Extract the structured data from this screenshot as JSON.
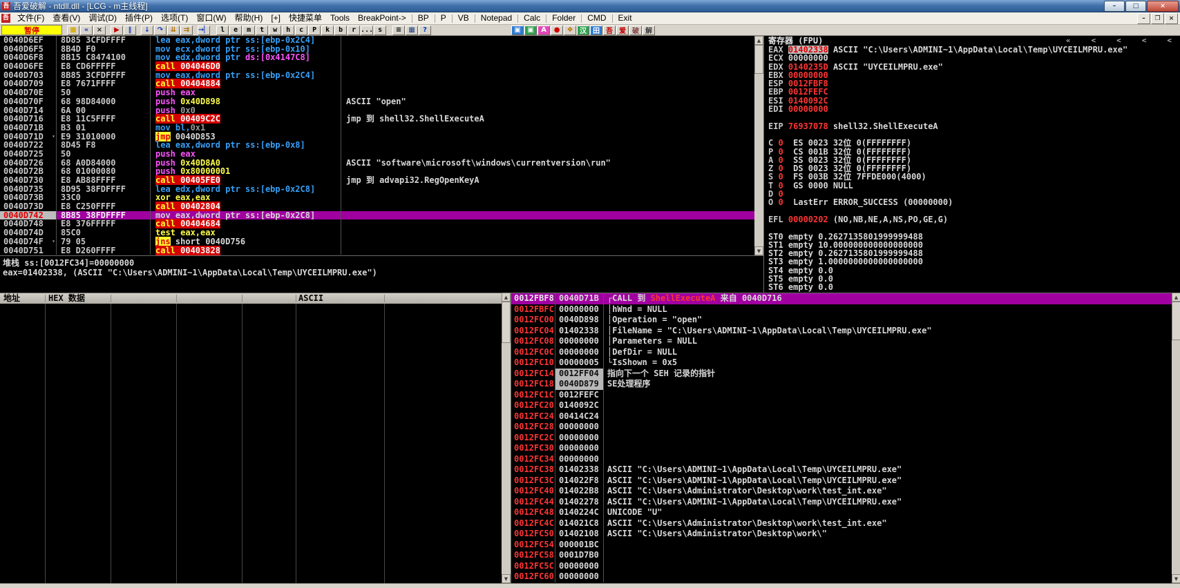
{
  "window": {
    "title": "吾爱破解 - ntdll.dll - [LCG - m主线程]",
    "icon_char": "吾",
    "controls": {
      "minimize": "–",
      "maximize": "□",
      "close": "×"
    },
    "mdi_controls": {
      "minimize": "–",
      "restore": "❐",
      "close": "×"
    }
  },
  "scrollbar": {
    "up": "▲",
    "down": "▼"
  },
  "menu": {
    "items": [
      {
        "label": "文件(F)"
      },
      {
        "label": "查看(V)"
      },
      {
        "label": "调试(D)"
      },
      {
        "label": "插件(P)"
      },
      {
        "label": "选项(T)"
      },
      {
        "label": "窗口(W)"
      },
      {
        "label": "帮助(H)"
      },
      {
        "label": "[+]"
      },
      {
        "label": "快捷菜单"
      },
      {
        "label": "Tools"
      },
      {
        "label": "BreakPoint->"
      },
      {
        "label": "BP",
        "sep_before": true
      },
      {
        "label": "P",
        "sep_before": true
      },
      {
        "label": "VB",
        "sep_before": true
      },
      {
        "label": "Notepad",
        "sep_before": true
      },
      {
        "label": "Calc",
        "sep_before": true
      },
      {
        "label": "Folder",
        "sep_before": true
      },
      {
        "label": "CMD",
        "sep_before": true
      },
      {
        "label": "Exit",
        "sep_before": true
      }
    ]
  },
  "toolbar": {
    "status_label": "暂停",
    "main_buttons": [
      {
        "name": "open-file-button",
        "glyph": "■",
        "fg": "#D8B020"
      },
      {
        "name": "restart-button",
        "glyph": "«",
        "fg": "#2040C0"
      },
      {
        "name": "close-program-button",
        "glyph": "×",
        "fg": "#202020"
      },
      {
        "name": "run-button",
        "glyph": "▶",
        "fg": "#C00000",
        "gap": true
      },
      {
        "name": "pause-button",
        "glyph": "‖",
        "fg": "#2040C0"
      },
      {
        "name": "step-into-button",
        "glyph": "↓",
        "fg": "#2040C0",
        "gap": true
      },
      {
        "name": "step-over-button",
        "glyph": "↷",
        "fg": "#2040C0"
      },
      {
        "name": "animate-into-button",
        "glyph": "⇊",
        "fg": "#B07000"
      },
      {
        "name": "animate-over-button",
        "glyph": "⇉",
        "fg": "#B07000"
      },
      {
        "name": "run-to-return-button",
        "glyph": "→▏",
        "fg": "#2040C0",
        "gap": true
      }
    ],
    "letter_buttons": [
      "l",
      "e",
      "m",
      "t",
      "w",
      "h",
      "c",
      "P",
      "k",
      "b",
      "r",
      "...",
      "s"
    ],
    "extra_buttons": [
      {
        "name": "breakpoint-list-button",
        "glyph": "≡",
        "fg": "#000000"
      },
      {
        "name": "patch-window-button",
        "glyph": "▦",
        "fg": "#204080"
      },
      {
        "name": "help-button",
        "glyph": "?",
        "fg": "#0040C0"
      }
    ],
    "plugin_buttons": [
      {
        "name": "terminal-plugin-icon",
        "glyph": "▣",
        "fg": "#FFFFFF",
        "bg": "#2F7BD0"
      },
      {
        "name": "green-tool-plugin-icon",
        "glyph": "▣",
        "fg": "#FFFFFF",
        "bg": "#2FA050"
      },
      {
        "name": "api-break-plugin-icon",
        "glyph": "A",
        "fg": "#FFFFFF",
        "bg": "#E048B8"
      },
      {
        "name": "record-plugin-icon",
        "glyph": "●",
        "fg": "#D00000",
        "bg": "#D8D4CB"
      },
      {
        "name": "spider-plugin-icon",
        "glyph": "❖",
        "fg": "#C07000",
        "bg": "#D8D4CB"
      },
      {
        "name": "chinese-tool-plugin-icon",
        "glyph": "汉",
        "fg": "#FFFFFF",
        "bg": "#2FA050"
      },
      {
        "name": "grid-plugin-icon",
        "glyph": "田",
        "fg": "#FFFFFF",
        "bg": "#2F7BD0"
      },
      {
        "name": "wu-plugin-icon",
        "glyph": "吾",
        "fg": "#C00000",
        "bg": "#D8D4CB"
      },
      {
        "name": "ai-plugin-icon",
        "glyph": "爱",
        "fg": "#C00000",
        "bg": "#D8D4CB"
      },
      {
        "name": "po-plugin-icon",
        "glyph": "破",
        "fg": "#804040",
        "bg": "#D8D4CB"
      },
      {
        "name": "jie-plugin-icon",
        "glyph": "解",
        "fg": "#404040",
        "bg": "#D8D4CB"
      }
    ]
  },
  "disasm": {
    "rows": [
      {
        "a": "0040D6EF",
        "b": "8D85 3CFDFFFF",
        "ins": [
          [
            "lea eax,dword ptr ss:[ebp-0x2C4]",
            "b"
          ]
        ],
        "cm": ""
      },
      {
        "a": "0040D6F5",
        "b": "8B4D F0",
        "ins": [
          [
            "mov ecx,dword ptr ss:[ebp-0x10]",
            "b"
          ]
        ],
        "cm": ""
      },
      {
        "a": "0040D6F8",
        "b": "8B15 C8474100",
        "ins": [
          [
            "mov edx,dword ptr ",
            "b"
          ],
          [
            "ds:[0x4147C8]",
            "m"
          ]
        ],
        "cm": ""
      },
      {
        "a": "0040D6FE",
        "b": "E8 CD6FFFFF",
        "ins": [
          [
            "call",
            "cr"
          ],
          [
            " 004046D0",
            "co"
          ]
        ],
        "cm": ""
      },
      {
        "a": "0040D703",
        "b": "8B85 3CFDFFFF",
        "ins": [
          [
            "mov eax,dword ptr ss:[ebp-0x2C4]",
            "b"
          ]
        ],
        "cm": ""
      },
      {
        "a": "0040D709",
        "b": "E8 7671FFFF",
        "ins": [
          [
            "call",
            "cr"
          ],
          [
            " 00404884",
            "co"
          ]
        ],
        "cm": ""
      },
      {
        "a": "0040D70E",
        "b": "50",
        "ins": [
          [
            "push eax",
            "m"
          ]
        ],
        "cm": ""
      },
      {
        "a": "0040D70F",
        "b": "68 98D84000",
        "ins": [
          [
            "push ",
            "m"
          ],
          [
            "0x40D898",
            "y"
          ]
        ],
        "cm": "ASCII \"open\""
      },
      {
        "a": "0040D714",
        "b": "6A 00",
        "ins": [
          [
            "push ",
            "m"
          ],
          [
            "0x0",
            "g"
          ]
        ],
        "cm": ""
      },
      {
        "a": "0040D716",
        "b": "E8 11C5FFFF",
        "ins": [
          [
            "call",
            "cr"
          ],
          [
            " 00409C2C",
            "co"
          ]
        ],
        "cm": "jmp 到 shell32.ShellExecuteA"
      },
      {
        "a": "0040D71B",
        "b": "B3 01",
        "ins": [
          [
            "mov bl,",
            "b"
          ],
          [
            "0x1",
            "g"
          ]
        ],
        "cm": ""
      },
      {
        "a": "0040D71D",
        "b": "E9 31010000",
        "ins": [
          [
            "jmp",
            "j"
          ],
          [
            " 0040D853",
            "w"
          ]
        ],
        "cm": "",
        "mk": "▾"
      },
      {
        "a": "0040D722",
        "b": "8D45 F8",
        "ins": [
          [
            "lea eax,dword ptr ss:[ebp-0x8]",
            "b"
          ]
        ],
        "cm": ""
      },
      {
        "a": "0040D725",
        "b": "50",
        "ins": [
          [
            "push eax",
            "m"
          ]
        ],
        "cm": ""
      },
      {
        "a": "0040D726",
        "b": "68 A0D84000",
        "ins": [
          [
            "push ",
            "m"
          ],
          [
            "0x40D8A0",
            "y"
          ]
        ],
        "cm": "ASCII \"software\\microsoft\\windows\\currentversion\\run\""
      },
      {
        "a": "0040D72B",
        "b": "68 01000080",
        "ins": [
          [
            "push ",
            "m"
          ],
          [
            "0x80000001",
            "y"
          ]
        ],
        "cm": ""
      },
      {
        "a": "0040D730",
        "b": "E8 AB88FFFF",
        "ins": [
          [
            "call",
            "cr"
          ],
          [
            " 00405FE0",
            "co"
          ]
        ],
        "cm": "jmp 到 advapi32.RegOpenKeyA"
      },
      {
        "a": "0040D735",
        "b": "8D95 38FDFFFF",
        "ins": [
          [
            "lea edx,dword ptr ss:[ebp-0x2C8]",
            "b"
          ]
        ],
        "cm": ""
      },
      {
        "a": "0040D73B",
        "b": "33C0",
        "ins": [
          [
            "xor eax,eax",
            "y"
          ]
        ],
        "cm": ""
      },
      {
        "a": "0040D73D",
        "b": "E8 C250FFFF",
        "ins": [
          [
            "call",
            "cr"
          ],
          [
            " 00402804",
            "co"
          ]
        ],
        "cm": ""
      },
      {
        "a": "0040D742",
        "b": "8B85 38FDFFFF",
        "ins": [
          [
            "mov eax,dword ptr ss:[ebp-0x2C8]",
            "w"
          ]
        ],
        "cm": "",
        "sel": true
      },
      {
        "a": "0040D748",
        "b": "E8 376FFFFF",
        "ins": [
          [
            "call",
            "cr"
          ],
          [
            " 00404684",
            "co"
          ]
        ],
        "cm": ""
      },
      {
        "a": "0040D74D",
        "b": "85C0",
        "ins": [
          [
            "test eax,eax",
            "y"
          ]
        ],
        "cm": ""
      },
      {
        "a": "0040D74F",
        "b": "79 05",
        "ins": [
          [
            "jns",
            "j"
          ],
          [
            " short 0040D756",
            "w"
          ]
        ],
        "cm": "",
        "mk": "▾"
      },
      {
        "a": "0040D751",
        "b": "E8 D260FFFF",
        "ins": [
          [
            "call",
            "cr"
          ],
          [
            " 00403828",
            "co"
          ]
        ],
        "cm": ""
      }
    ]
  },
  "info_pane": {
    "line1": "堆栈 ss:[0012FC34]=00000000",
    "line2": "eax=01402338, (ASCII \"C:\\Users\\ADMINI~1\\AppData\\Local\\Temp\\UYCEILMPRU.exe\")"
  },
  "registers": {
    "title": "寄存器 (FPU)",
    "nav": [
      "«",
      "<",
      "<",
      "<",
      "<"
    ],
    "rows": [
      [
        [
          "EAX ",
          "n"
        ],
        [
          "01402338",
          "sr"
        ],
        [
          " ",
          "n"
        ],
        [
          "ASCII \"C:\\Users\\ADMINI~1\\AppData\\Local\\Temp\\UYCEILMPRU.exe\"",
          "w"
        ]
      ],
      [
        [
          "ECX ",
          "n"
        ],
        [
          "00000000",
          "w"
        ]
      ],
      [
        [
          "EDX ",
          "n"
        ],
        [
          "0140235D",
          "r"
        ],
        [
          " ",
          "n"
        ],
        [
          "ASCII \"UYCEILMPRU.exe\"",
          "w"
        ]
      ],
      [
        [
          "EBX ",
          "n"
        ],
        [
          "00000000",
          "r"
        ]
      ],
      [
        [
          "ESP ",
          "n"
        ],
        [
          "0012FBF8",
          "r"
        ]
      ],
      [
        [
          "EBP ",
          "n"
        ],
        [
          "0012FEFC",
          "r"
        ]
      ],
      [
        [
          "ESI ",
          "n"
        ],
        [
          "0140092C",
          "r"
        ]
      ],
      [
        [
          "EDI ",
          "n"
        ],
        [
          "00000000",
          "r"
        ]
      ],
      [],
      [
        [
          "EIP ",
          "n"
        ],
        [
          "76937078",
          "r"
        ],
        [
          " shell32.ShellExecuteA",
          "w"
        ]
      ],
      [],
      [
        [
          "C ",
          "n"
        ],
        [
          "0",
          "r"
        ],
        [
          "  ES 0023 32位 0(FFFFFFFF)",
          "w"
        ]
      ],
      [
        [
          "P ",
          "n"
        ],
        [
          "0",
          "r"
        ],
        [
          "  CS 001B 32位 0(FFFFFFFF)",
          "w"
        ]
      ],
      [
        [
          "A ",
          "n"
        ],
        [
          "0",
          "r"
        ],
        [
          "  SS 0023 32位 0(FFFFFFFF)",
          "w"
        ]
      ],
      [
        [
          "Z ",
          "n"
        ],
        [
          "0",
          "r"
        ],
        [
          "  DS 0023 32位 0(FFFFFFFF)",
          "w"
        ]
      ],
      [
        [
          "S ",
          "n"
        ],
        [
          "0",
          "r"
        ],
        [
          "  FS 003B 32位 7FFDE000(4000)",
          "w"
        ]
      ],
      [
        [
          "T ",
          "n"
        ],
        [
          "0",
          "r"
        ],
        [
          "  GS 0000 NULL",
          "w"
        ]
      ],
      [
        [
          "D ",
          "n"
        ],
        [
          "0",
          "r"
        ]
      ],
      [
        [
          "O ",
          "n"
        ],
        [
          "0",
          "r"
        ],
        [
          "  LastErr ERROR_SUCCESS (00000000)",
          "w"
        ]
      ],
      [],
      [
        [
          "EFL ",
          "n"
        ],
        [
          "00000202",
          "r"
        ],
        [
          " (NO,NB,NE,A,NS,PO,GE,G)",
          "w"
        ]
      ],
      [],
      [
        [
          "ST0 empty 0.2627135801999999488",
          "w"
        ]
      ],
      [
        [
          "ST1 empty 10.000000000000000000",
          "w"
        ]
      ],
      [
        [
          "ST2 empty 0.2627135801999999488",
          "w"
        ]
      ],
      [
        [
          "ST3 empty 1.0000000000000000000",
          "w"
        ]
      ],
      [
        [
          "ST4 empty 0.0",
          "w"
        ]
      ],
      [
        [
          "ST5 empty 0.0",
          "w"
        ]
      ],
      [
        [
          "ST6 empty 0.0",
          "w"
        ]
      ],
      [
        [
          "ST7 empty 0.0",
          "w"
        ]
      ]
    ]
  },
  "dump": {
    "col_addr": "地址",
    "col_hex": "HEX 数据",
    "col_ascii": "ASCII"
  },
  "stack": {
    "rows": [
      {
        "a": "0012FBF8",
        "v": "0040D71B",
        "sel": true,
        "cm": [
          [
            "┌CALL 到 ",
            "w"
          ],
          [
            "ShellExecuteA",
            "r"
          ],
          [
            " 来自 ",
            "w"
          ],
          [
            "0040D716",
            "w"
          ]
        ]
      },
      {
        "a": "0012FBFC",
        "v": "00000000",
        "cm": [
          [
            "│hWnd = NULL",
            "w"
          ]
        ]
      },
      {
        "a": "0012FC00",
        "v": "0040D898",
        "cm": [
          [
            "│Operation = \"open\"",
            "w"
          ]
        ]
      },
      {
        "a": "0012FC04",
        "v": "01402338",
        "cm": [
          [
            "│FileName = \"C:\\Users\\ADMINI~1\\AppData\\Local\\Temp\\UYCEILMPRU.exe\"",
            "w"
          ]
        ]
      },
      {
        "a": "0012FC08",
        "v": "00000000",
        "cm": [
          [
            "│Parameters = NULL",
            "w"
          ]
        ]
      },
      {
        "a": "0012FC0C",
        "v": "00000000",
        "cm": [
          [
            "│DefDir = NULL",
            "w"
          ]
        ]
      },
      {
        "a": "0012FC10",
        "v": "00000005",
        "cm": [
          [
            "└IsShown = 0x5",
            "w"
          ]
        ]
      },
      {
        "a": "0012FC14",
        "v": "0012FF04",
        "vseh": true,
        "cm": [
          [
            "指向下一个 SEH 记录的指针",
            "w"
          ]
        ]
      },
      {
        "a": "0012FC18",
        "v": "0040D879",
        "vseh": true,
        "cm": [
          [
            "SE处理程序",
            "w"
          ]
        ]
      },
      {
        "a": "0012FC1C",
        "v": "0012FEFC",
        "cm": []
      },
      {
        "a": "0012FC20",
        "v": "0140092C",
        "cm": []
      },
      {
        "a": "0012FC24",
        "v": "00414C24",
        "cm": []
      },
      {
        "a": "0012FC28",
        "v": "00000000",
        "cm": []
      },
      {
        "a": "0012FC2C",
        "v": "00000000",
        "cm": []
      },
      {
        "a": "0012FC30",
        "v": "00000000",
        "cm": []
      },
      {
        "a": "0012FC34",
        "v": "00000000",
        "cm": []
      },
      {
        "a": "0012FC38",
        "v": "01402338",
        "cm": [
          [
            "ASCII \"C:\\Users\\ADMINI~1\\AppData\\Local\\Temp\\UYCEILMPRU.exe\"",
            "w"
          ]
        ]
      },
      {
        "a": "0012FC3C",
        "v": "014022F8",
        "cm": [
          [
            "ASCII \"C:\\Users\\ADMINI~1\\AppData\\Local\\Temp\\UYCEILMPRU.exe\"",
            "w"
          ]
        ]
      },
      {
        "a": "0012FC40",
        "v": "014022B8",
        "cm": [
          [
            "ASCII \"C:\\Users\\Administrator\\Desktop\\work\\test_int.exe\"",
            "w"
          ]
        ]
      },
      {
        "a": "0012FC44",
        "v": "01402278",
        "cm": [
          [
            "ASCII \"C:\\Users\\ADMINI~1\\AppData\\Local\\Temp\\UYCEILMPRU.exe\"",
            "w"
          ]
        ]
      },
      {
        "a": "0012FC48",
        "v": "0140224C",
        "cm": [
          [
            "UNICODE \"U\"",
            "w"
          ]
        ]
      },
      {
        "a": "0012FC4C",
        "v": "014021C8",
        "cm": [
          [
            "ASCII \"C:\\Users\\Administrator\\Desktop\\work\\test_int.exe\"",
            "w"
          ]
        ]
      },
      {
        "a": "0012FC50",
        "v": "01402108",
        "cm": [
          [
            "ASCII \"C:\\Users\\Administrator\\Desktop\\work\\\"",
            "w"
          ]
        ]
      },
      {
        "a": "0012FC54",
        "v": "000001BC",
        "cm": []
      },
      {
        "a": "0012FC58",
        "v": "0001D7B0",
        "cm": []
      },
      {
        "a": "0012FC5C",
        "v": "00000000",
        "cm": []
      },
      {
        "a": "0012FC60",
        "v": "00000000",
        "cm": []
      }
    ]
  }
}
